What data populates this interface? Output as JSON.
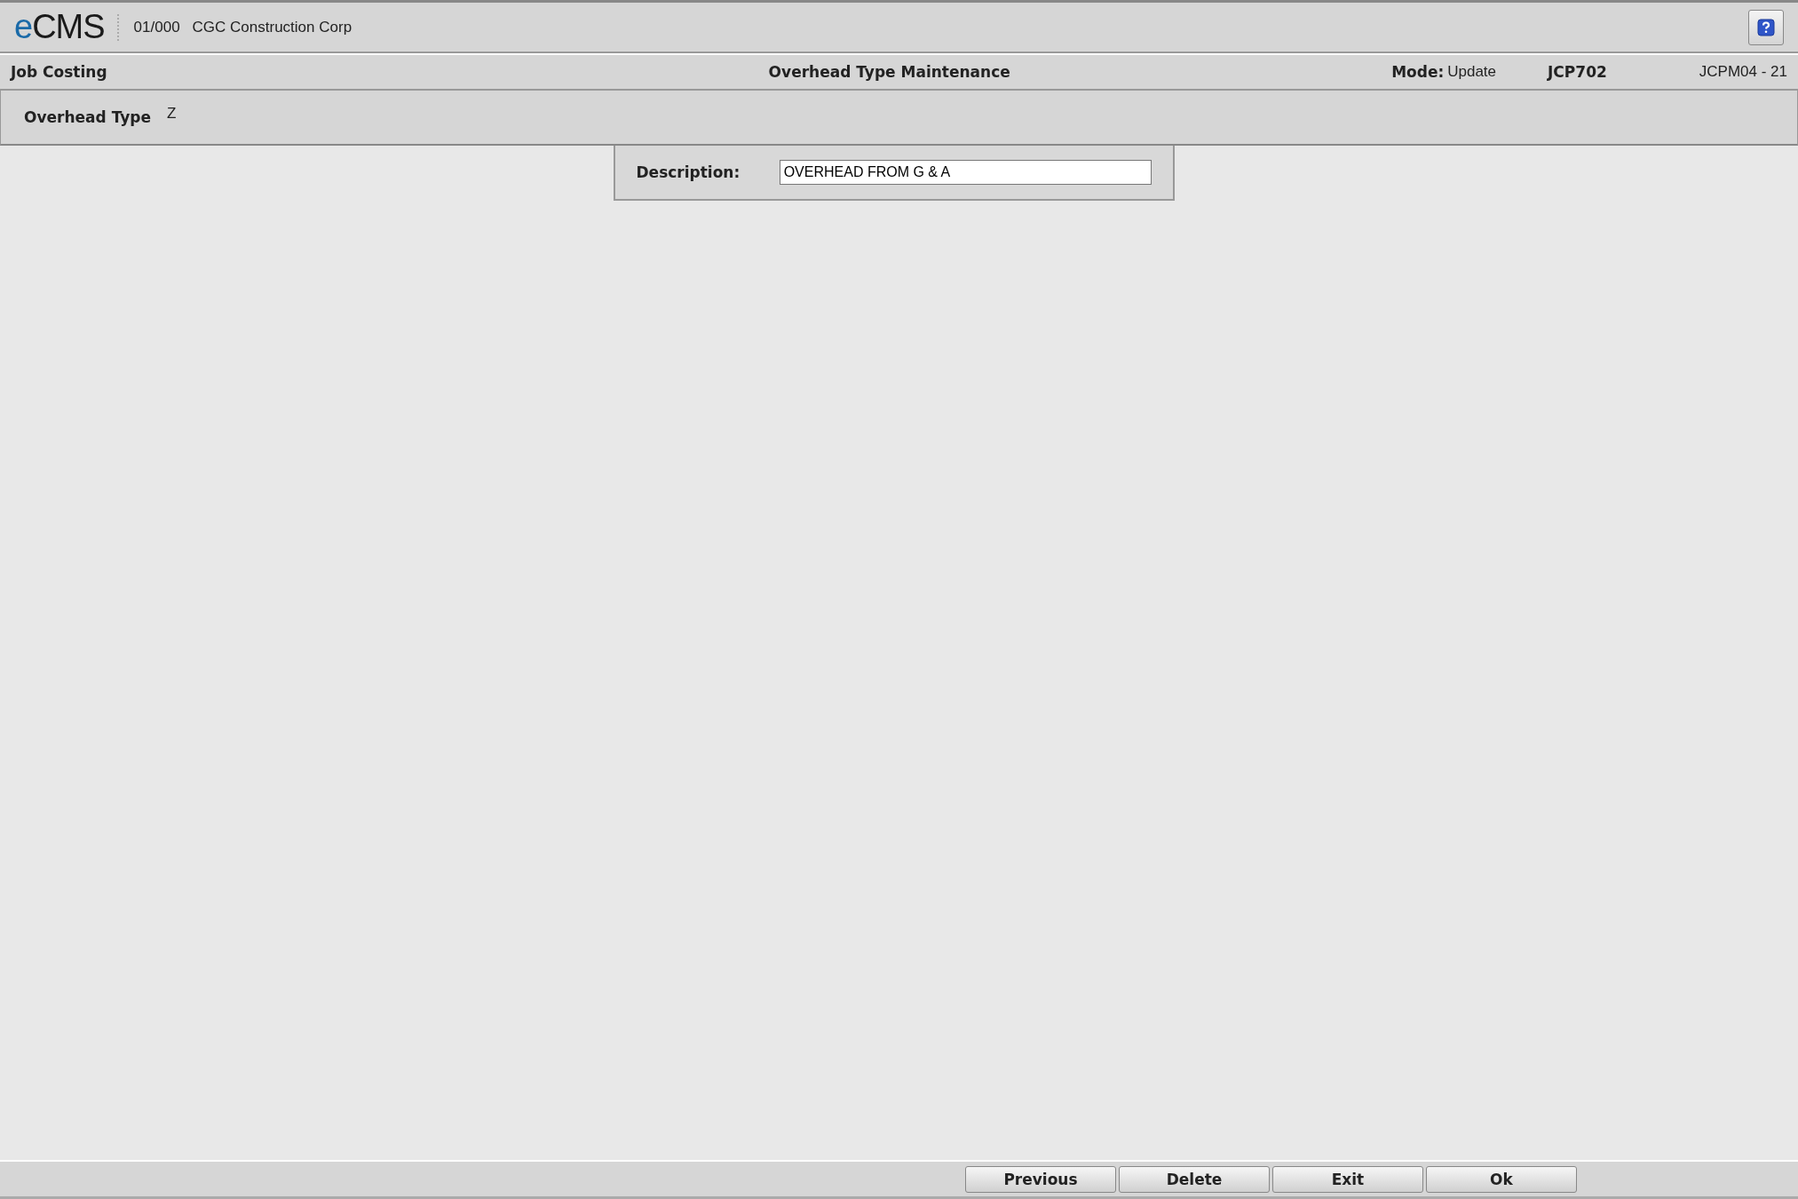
{
  "header": {
    "logo": {
      "accent": "e",
      "rest": "CMS"
    },
    "company_code": "01/000",
    "company_name": "CGC Construction Corp"
  },
  "title_bar": {
    "module": "Job Costing",
    "title": "Overhead Type Maintenance",
    "mode_label": "Mode:",
    "mode_value": "Update",
    "program": "JCP702",
    "screen_id": "JCPM04 - 21"
  },
  "key_panel": {
    "label": "Overhead Type",
    "value": "Z"
  },
  "form": {
    "label": "Description:",
    "value": "OVERHEAD FROM G & A"
  },
  "buttons": [
    "Previous",
    "Delete",
    "Exit",
    "Ok"
  ]
}
